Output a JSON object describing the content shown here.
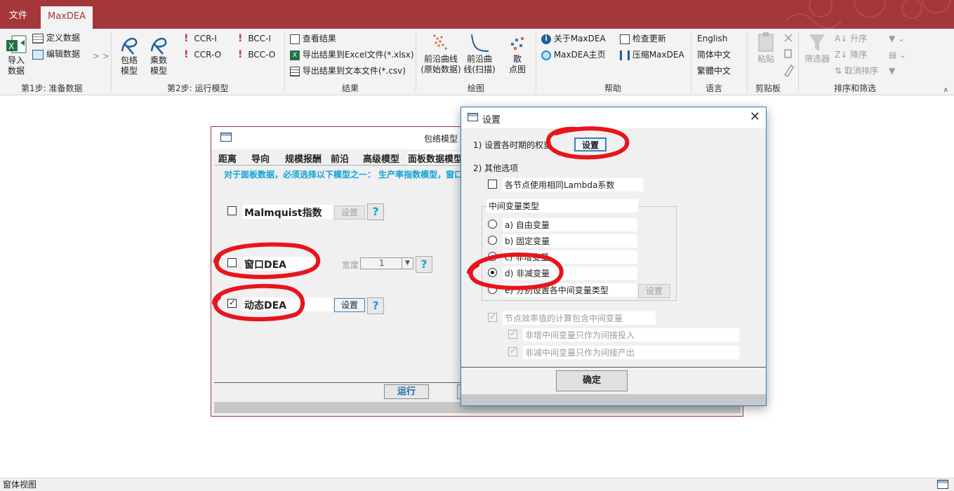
{
  "tabs": {
    "file": "文件",
    "maxdea": "MaxDEA"
  },
  "ribbon": {
    "import_data": "导入\n数据",
    "define_data": "定义数据",
    "edit_data": "编辑数据",
    "more": "> >",
    "group1": "第1步: 准备数据",
    "envelope_model_1": "包络",
    "envelope_model_2": "模型",
    "multiplier_model_1": "乘数",
    "multiplier_model_2": "模型",
    "ccr_i": "CCR-I",
    "ccr_o": "CCR-O",
    "bcc_i": "BCC-I",
    "bcc_o": "BCC-O",
    "group2": "第2步: 运行模型",
    "view_results": "查看结果",
    "export_excel": "导出结果到Excel文件(*.xlsx)",
    "export_text": "导出结果到文本文件(*.csv)",
    "group3": "结果",
    "frontier_raw_1": "前沿曲线",
    "frontier_raw_2": "(原始数据)",
    "frontier_scan_1": "前沿曲",
    "frontier_scan_2": "线(扫描)",
    "scatter_1": "散",
    "scatter_2": "点图",
    "group4": "绘图",
    "about": "关于MaxDEA",
    "homepage": "MaxDEA主页",
    "check_update": "检查更新",
    "compress": "压缩MaxDEA",
    "group5": "帮助",
    "english": "English",
    "simplified": "简体中文",
    "traditional": "繁體中文",
    "group6": "语言",
    "paste": "粘贴",
    "group7": "剪贴板",
    "filter": "筛选器",
    "sort_asc": "升序",
    "sort_desc": "降序",
    "clear_sort": "取消排序",
    "group8": "排序和筛选"
  },
  "bgform": {
    "title": "包络模型",
    "tabs": [
      "距离",
      "导向",
      "规模报酬",
      "前沿",
      "高级模型",
      "面板数据模型"
    ],
    "note": "对于面板数据，必须选择以下模型之一：  生产率指数模型，窗口",
    "malmquist": "Malmquist指数",
    "window_dea": "窗口DEA",
    "dynamic_dea": "动态DEA",
    "settings": "设置",
    "width_label": "宽度",
    "width_value": "1",
    "help": "?",
    "run": "运行"
  },
  "dialog": {
    "title": "设置",
    "close": "✕",
    "item1": "1) 设置各时期的权重",
    "item1_btn": "设置",
    "item2": "2) 其他选项",
    "same_lambda": "各节点使用相同Lambda系数",
    "intermediate_type": "中间变量类型",
    "opt_a": "a) 自由变量",
    "opt_b": "b) 固定变量",
    "opt_c": "c) 非增变量",
    "opt_d": "d) 非减变量",
    "opt_e": "e) 分别设置各中间变量类型",
    "opt_e_btn": "设置",
    "node_eff": "节点效率值的计算包含中间变量",
    "nonincr_input": "非增中间变量只作为间接投入",
    "nondecr_output": "非减中间变量只作为间接产出",
    "ok": "确定"
  },
  "status": "窗体视图",
  "colors": {
    "accent": "#a4373a",
    "dialog_border": "#2b79c2",
    "annotation": "#e8141c",
    "note": "#0ea2d6"
  }
}
